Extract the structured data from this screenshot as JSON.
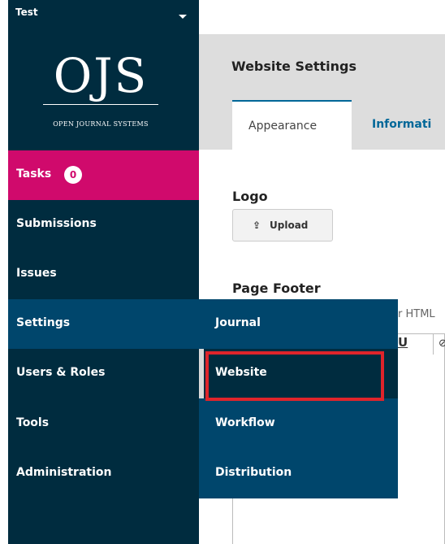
{
  "context": {
    "name": "Test"
  },
  "logo": {
    "main": "OJS",
    "sub": "OPEN JOURNAL SYSTEMS"
  },
  "nav": {
    "tasks": {
      "label": "Tasks",
      "count": "0"
    },
    "items": [
      "Submissions",
      "Issues",
      "Settings",
      "Users & Roles",
      "Tools",
      "Administration"
    ]
  },
  "header": {
    "title": "Website Settings"
  },
  "tabs": [
    "Appearance",
    "Informati"
  ],
  "content": {
    "logo_heading": "Logo",
    "upload_label": "Upload",
    "footer_heading": "Page Footer",
    "helper_fragment": "r HTML",
    "editor_underline": "U"
  },
  "submenu": [
    "Journal",
    "Website",
    "Workflow",
    "Distribution"
  ],
  "colors": {
    "sidebar": "#002c3f",
    "tasks_active": "#d00a6c",
    "settings_active": "#00466c",
    "tab_link": "#006798",
    "highlight": "#e0242b"
  }
}
